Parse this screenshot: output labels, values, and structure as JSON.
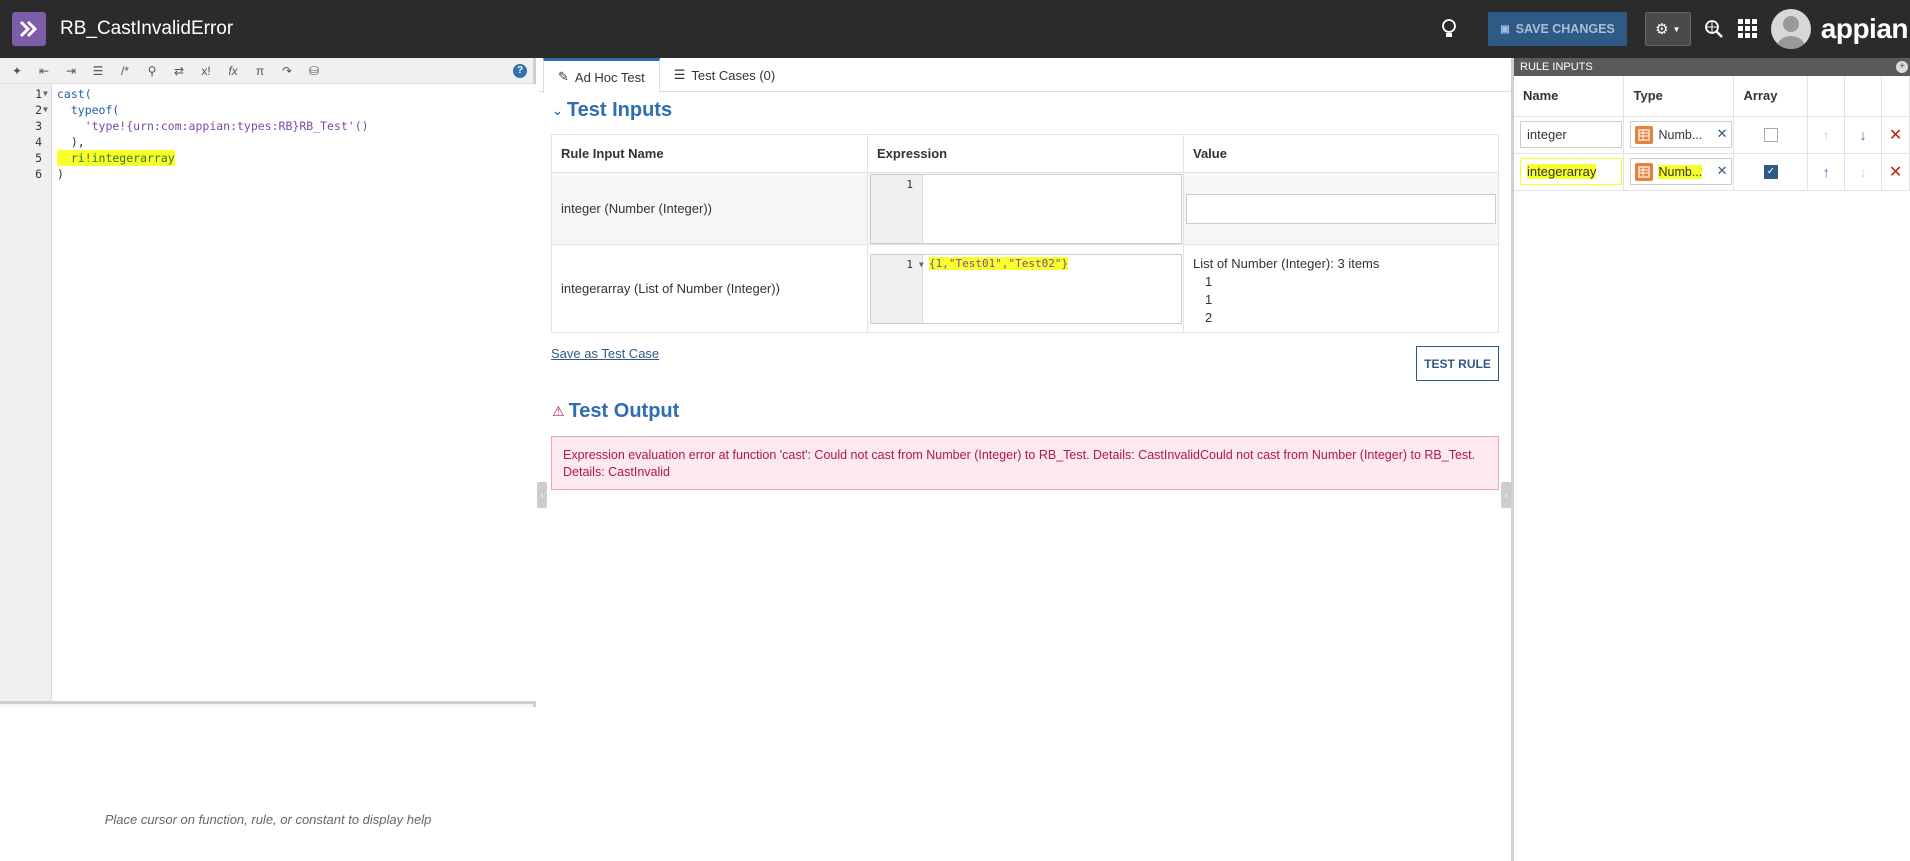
{
  "header": {
    "title": "RB_CastInvalidError",
    "save_label": "SAVE CHANGES",
    "brand": "appian"
  },
  "editor": {
    "toolbar_icons": [
      "magic-wand-icon",
      "outdent-icon",
      "indent-icon",
      "list-icon",
      "comment-icon",
      "search-icon",
      "shuffle-icon",
      "variable-icon",
      "function-icon",
      "constant-icon",
      "export-icon",
      "database-icon"
    ],
    "lines": [
      {
        "n": "1",
        "text": "cast("
      },
      {
        "n": "2",
        "text": "  typeof("
      },
      {
        "n": "3",
        "text": "    'type!{urn:com:appian:types:RB}RB_Test'()"
      },
      {
        "n": "4",
        "text": "  ),"
      },
      {
        "n": "5",
        "text": "  ri!integerarray"
      },
      {
        "n": "6",
        "text": ")"
      }
    ],
    "help_text": "Place cursor on function, rule, or constant to display help"
  },
  "tabs": [
    {
      "label": "Ad Hoc Test"
    },
    {
      "label": "Test Cases (0)"
    }
  ],
  "test_inputs": {
    "heading": "Test Inputs",
    "columns": [
      "Rule Input Name",
      "Expression",
      "Value"
    ],
    "rows": [
      {
        "name": "integer (Number (Integer))",
        "line": "1",
        "expression": "",
        "value": ""
      },
      {
        "name": "integerarray (List of Number (Integer))",
        "line": "1",
        "expression": "{1,\"Test01\",\"Test02\"}",
        "value_title": "List of Number (Integer): 3 items",
        "value_items": [
          "1",
          "1",
          "2"
        ]
      }
    ],
    "save_case": "Save as Test Case",
    "test_rule": "TEST RULE"
  },
  "test_output": {
    "heading": "Test Output",
    "error": "Expression evaluation error at function 'cast': Could not cast from Number (Integer) to RB_Test. Details: CastInvalidCould not cast from Number (Integer) to RB_Test. Details: CastInvalid"
  },
  "rule_inputs": {
    "heading": "RULE INPUTS",
    "columns": [
      "Name",
      "Type",
      "Array"
    ],
    "rows": [
      {
        "name": "integer",
        "type": "Numb...",
        "array": false
      },
      {
        "name": "integerarray",
        "type": "Numb...",
        "array": true
      }
    ]
  },
  "colors": {
    "accent": "#2e6db4",
    "topbar": "#2b2b2b",
    "highlight": "#f8ff2a",
    "error_text": "#b0174a",
    "error_bg": "#fbe9ee"
  }
}
